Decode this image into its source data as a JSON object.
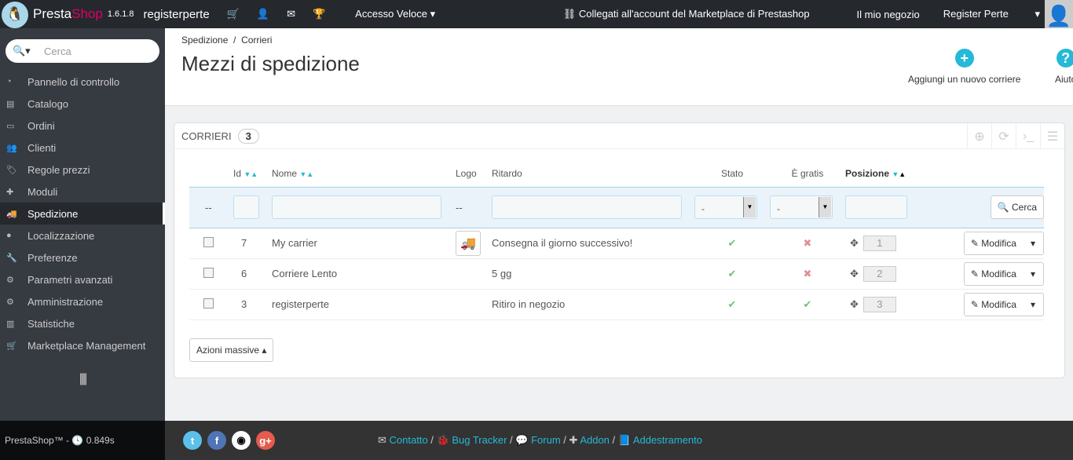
{
  "topbar": {
    "brand_a": "Presta",
    "brand_b": "Shop",
    "version": "1.6.1.8",
    "shop": "registerperte",
    "quick_access": "Accesso Veloce",
    "marketplace": "Collegati all'account del Marketplace di Prestashop",
    "my_shop": "Il mio negozio",
    "user": "Register Perte"
  },
  "sidebar": {
    "search_placeholder": "Cerca",
    "items": [
      {
        "label": "Pannello di controllo",
        "icon": "dashboard-icon",
        "g": "◔"
      },
      {
        "label": "Catalogo",
        "icon": "book-icon",
        "g": "▤"
      },
      {
        "label": "Ordini",
        "icon": "credit-card-icon",
        "g": "▭"
      },
      {
        "label": "Clienti",
        "icon": "users-icon",
        "g": "👥"
      },
      {
        "label": "Regole prezzi",
        "icon": "tags-icon",
        "g": "🏷"
      },
      {
        "label": "Moduli",
        "icon": "puzzle-icon",
        "g": "✚"
      },
      {
        "label": "Spedizione",
        "icon": "truck-icon",
        "g": "🚚",
        "active": true
      },
      {
        "label": "Localizzazione",
        "icon": "globe-icon",
        "g": "●"
      },
      {
        "label": "Preferenze",
        "icon": "wrench-icon",
        "g": "🔧"
      },
      {
        "label": "Parametri avanzati",
        "icon": "cogs-icon",
        "g": "⚙"
      },
      {
        "label": "Amministrazione",
        "icon": "cog-icon",
        "g": "⚙"
      },
      {
        "label": "Statistiche",
        "icon": "bar-chart-icon",
        "g": "▥"
      },
      {
        "label": "Marketplace Management",
        "icon": "cart-icon",
        "g": "🛒"
      }
    ],
    "collapse": "||||"
  },
  "header": {
    "breadcrumb": [
      "Spedizione",
      "Corrieri"
    ],
    "title": "Mezzi di spedizione",
    "add_carrier": "Aggiungi un nuovo corriere",
    "help": "Aiuto"
  },
  "panel": {
    "title": "CORRIERI",
    "count": "3",
    "columns": {
      "id": "Id",
      "name": "Nome",
      "logo": "Logo",
      "delay": "Ritardo",
      "status": "Stato",
      "free": "È gratis",
      "position": "Posizione"
    },
    "filter": {
      "dash": "--",
      "logo_dash": "--",
      "status_value": "-",
      "free_value": "-",
      "search": "Cerca"
    },
    "rows": [
      {
        "id": "7",
        "name": "My carrier",
        "has_logo": true,
        "delay": "Consegna il giorno successivo!",
        "active": true,
        "free": false,
        "position": "1",
        "action": "Modifica"
      },
      {
        "id": "6",
        "name": "Corriere Lento",
        "has_logo": false,
        "delay": "5 gg",
        "active": true,
        "free": false,
        "position": "2",
        "action": "Modifica"
      },
      {
        "id": "3",
        "name": "registerperte",
        "has_logo": false,
        "delay": "Ritiro in negozio",
        "active": true,
        "free": true,
        "position": "3",
        "action": "Modifica"
      }
    ],
    "bulk": "Azioni massive"
  },
  "footer": {
    "brand": "PrestaShop™ -",
    "time": "0.849s",
    "links": [
      "Contatto",
      "Bug Tracker",
      "Forum",
      "Addon",
      "Addestramento"
    ]
  }
}
